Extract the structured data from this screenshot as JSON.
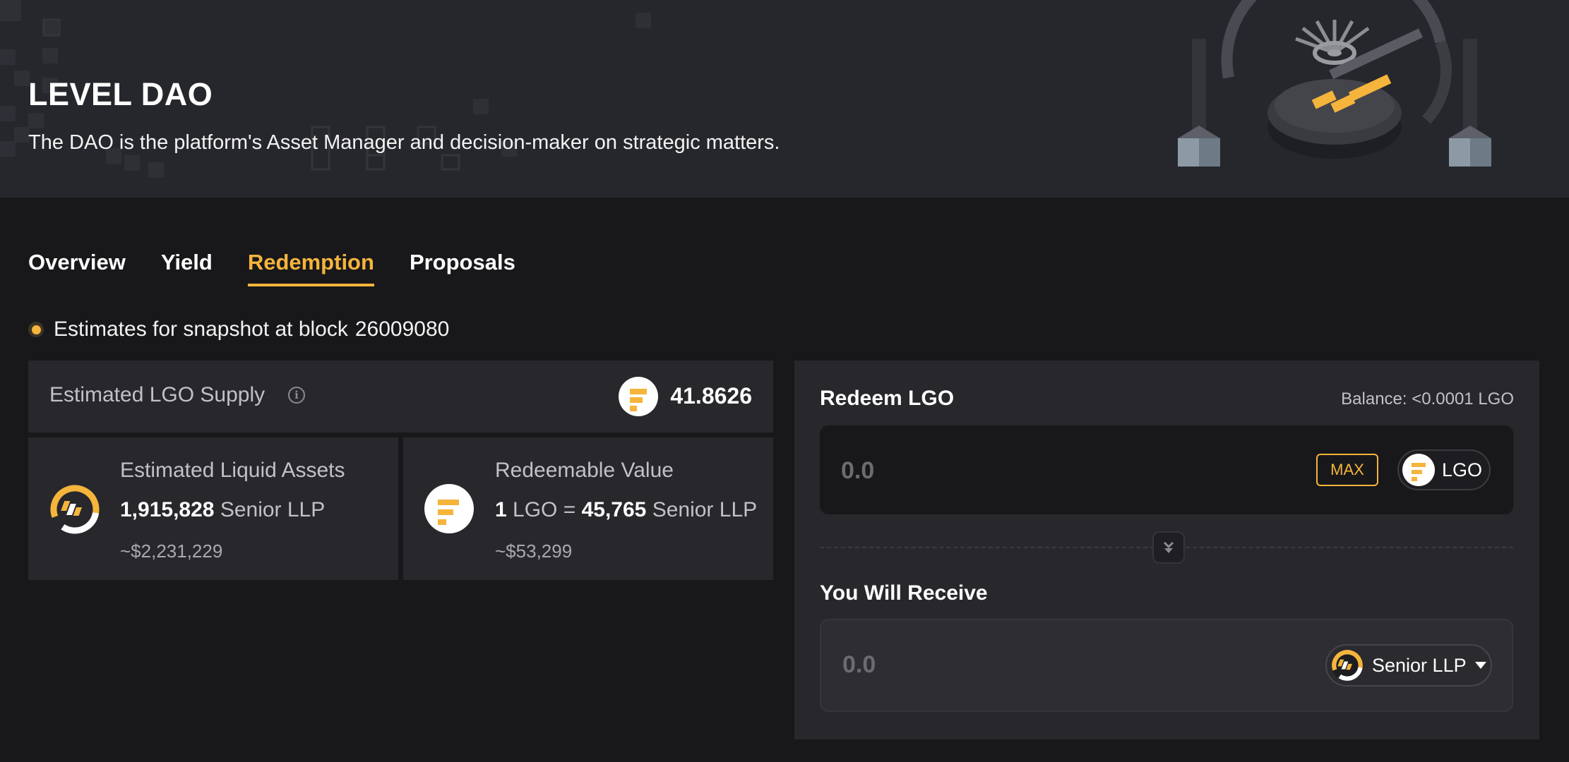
{
  "header": {
    "title": "LEVEL DAO",
    "subtitle": "The DAO is the platform's Asset Manager and decision-maker on strategic matters."
  },
  "tabs": [
    {
      "label": "Overview",
      "active": false
    },
    {
      "label": "Yield",
      "active": false
    },
    {
      "label": "Redemption",
      "active": true
    },
    {
      "label": "Proposals",
      "active": false
    }
  ],
  "snapshot": {
    "text": "Estimates for snapshot at block",
    "block": "26009080"
  },
  "supply": {
    "label": "Estimated LGO Supply",
    "value": "41.8626",
    "token_icon": "lgo-token-icon",
    "info_icon": "info-icon"
  },
  "liquid_assets": {
    "title": "Estimated Liquid Assets",
    "amount": "1,915,828",
    "unit": "Senior LLP",
    "usd": "~$2,231,229",
    "icon": "senior-llp-token-icon"
  },
  "redeemable": {
    "title": "Redeemable Value",
    "lhs_amount": "1",
    "lhs_unit": "LGO =",
    "rhs_amount": "45,765",
    "rhs_unit": "Senior LLP",
    "usd": "~$53,299",
    "icon": "lgo-token-icon"
  },
  "redeem_panel": {
    "title": "Redeem LGO",
    "balance": "Balance: <0.0001 LGO",
    "input_placeholder": "0.0",
    "max_label": "MAX",
    "token_label": "LGO",
    "receive_title": "You Will Receive",
    "receive_amount": "0.0",
    "receive_token_label": "Senior LLP"
  },
  "colors": {
    "accent": "#f5b43b",
    "background": "#18181b",
    "card": "#27272c"
  }
}
